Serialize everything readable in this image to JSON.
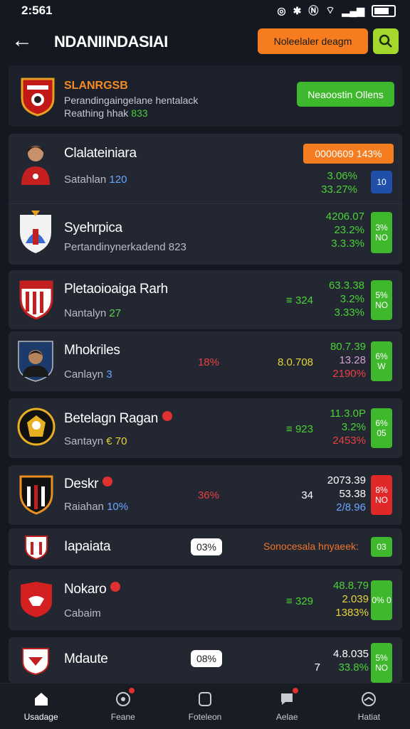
{
  "status_bar": {
    "time": "2:561"
  },
  "header": {
    "title": "NDANIINDASIAI",
    "action_label": "Noleelaler deagm"
  },
  "league_card": {
    "title": "SLANRGSB",
    "subtitle": "Perandingaingelane hentalack",
    "reach_label": "Reathing hhak",
    "reach_value": "833",
    "button_label": "Neaoostin Ollens"
  },
  "rows": [
    {
      "name": "Clalateiniara",
      "meta_label": "Satahlan",
      "meta_value": "120",
      "badge_label": "0000609 143%",
      "stats": [
        "3.06%",
        "33.27%"
      ],
      "side": "10"
    },
    {
      "name": "Syehrpica",
      "meta_label": "Pertandinynerkadend",
      "meta_value": "823",
      "stats": [
        "4206.07",
        "23.2%",
        "3.3.3%"
      ],
      "side": "3% NO"
    },
    {
      "name": "Pletaoioaiga Rarh",
      "meta_label": "Nantalyn",
      "meta_value": "27",
      "mid_value": "≡ 324",
      "stats": [
        "63.3.38",
        "3.2%",
        "3.33%"
      ],
      "side": "5% NO"
    },
    {
      "name": "Mhokriles",
      "meta_label": "Canlayn",
      "meta_value": "3",
      "pct": "18%",
      "mid_value": "8.0.708",
      "stats": [
        "80.7.39",
        "13.28",
        "2190%"
      ],
      "side": "6% W"
    },
    {
      "name": "Betelagn Ragan",
      "meta_label": "Santayn",
      "meta_value": "€ 70",
      "mid_value": "≡ 923",
      "stats": [
        "11.3.0P",
        "3.2%",
        "2453%"
      ],
      "side": "6% 05"
    },
    {
      "name": "Deskr",
      "meta_label": "Raiahan",
      "meta_value": "10%",
      "pct": "36%",
      "mid_value": "34",
      "stats": [
        "2073.39",
        "53.38",
        "2/8.96"
      ],
      "side": "8% NO"
    },
    {
      "name": "Iapaiata",
      "pill": "03%",
      "right_text": "Sonocesala hnyaeek:",
      "side": "03"
    },
    {
      "name": "Nokaro",
      "meta_label": "Cabaim",
      "mid_value": "≡ 329",
      "stats": [
        "48.8.79",
        "2.039",
        "1383%"
      ],
      "side": "0% 0"
    },
    {
      "name": "Mdaute",
      "pill": "08%",
      "mid_value": "7",
      "stats": [
        "4.8.035",
        "33.8%"
      ],
      "side": "5% NO"
    }
  ],
  "nav": [
    {
      "label": "Usadage",
      "icon": "home-icon"
    },
    {
      "label": "Feane",
      "icon": "ball-icon"
    },
    {
      "label": "Foteleon",
      "icon": "square-icon"
    },
    {
      "label": "Aelae",
      "icon": "chat-icon"
    },
    {
      "label": "Hatiat",
      "icon": "field-icon"
    }
  ],
  "colors": {
    "accent_orange": "#f57c1f",
    "accent_green": "#3fb82d",
    "lime": "#a4d82c",
    "background": "#141821",
    "card": "#222732"
  }
}
